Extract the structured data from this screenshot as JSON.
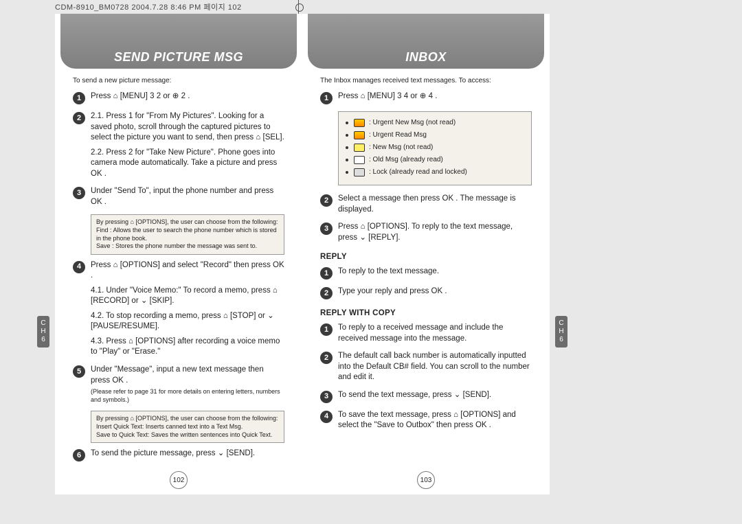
{
  "meta": {
    "top_line": "CDM-8910_BM0728  2004.7.28 8:46 PM  페이지 102"
  },
  "left": {
    "title": "SEND PICTURE MSG",
    "intro": "To send a new picture message:",
    "tab": {
      "a": "C",
      "b": "H",
      "c": "6"
    },
    "step1": "Press ⌂ [MENU] 3 2 or ⊕ 2 .",
    "step2_1": "2.1. Press 1 for \"From My Pictures\". Looking for a saved photo, scroll through the captured pictures to select the picture you want to send, then press ⌂ [SEL].",
    "step2_2": "2.2. Press 2 for \"Take New Picture\". Phone goes into camera mode automatically. Take a picture and press OK .",
    "step3": "Under \"Send To\", input the phone number and press OK .",
    "note1_l1": "By pressing ⌂ [OPTIONS], the user can choose from the following:",
    "note1_l2": "Find : Allows the user to search the phone number which is stored in the phone book.",
    "note1_l3": "Save : Stores the phone number the message was sent to.",
    "step4": "Press ⌂ [OPTIONS] and select \"Record\" then press OK .",
    "step4_1": "4.1. Under \"Voice Memo:\" To record a memo, press ⌂ [RECORD] or ⌄ [SKIP].",
    "step4_2": "4.2. To stop recording a memo, press ⌂ [STOP] or ⌄ [PAUSE/RESUME].",
    "step4_3": "4.3. Press ⌂ [OPTIONS] after recording a voice memo to \"Play\" or \"Erase.\"",
    "step5": "Under \"Message\", input a new text message then press OK .",
    "step5_note": "(Please refer to page 31 for more details on entering letters, numbers and symbols.)",
    "note2_l1": "By pressing ⌂ [OPTIONS], the user can choose from the following:",
    "note2_l2": "Insert Quick Text: Inserts canned text into a Text Msg.",
    "note2_l3": "Save to Quick Text: Saves the written sentences into Quick Text.",
    "step6": "To send the picture message, press ⌄ [SEND].",
    "page_num": "102"
  },
  "right": {
    "title": "INBOX",
    "intro": "The Inbox manages received text messages. To access:",
    "tab": {
      "a": "C",
      "b": "H",
      "c": "6"
    },
    "step1": "Press ⌂ [MENU] 3 4 or ⊕ 4 .",
    "legend": {
      "l1": ": Urgent New Msg (not read)",
      "l2": ": Urgent Read Msg",
      "l3": ": New Msg (not read)",
      "l4": ": Old Msg (already read)",
      "l5": ": Lock (already read and locked)"
    },
    "step2": "Select a message then press OK . The message is displayed.",
    "step3": "Press ⌂ [OPTIONS]. To reply to the text message, press ⌄ [REPLY].",
    "reply_head": "REPLY",
    "reply_1": "To reply to the text message.",
    "reply_2": "Type your reply and press OK .",
    "replycopy_head": "REPLY WITH COPY",
    "rc_1": "To reply to a received message and include the received message into the message.",
    "rc_2": "The default call back number is automatically inputted into the Default CB# field. You can scroll to the number and edit it.",
    "rc_3": "To send the text message, press ⌄ [SEND].",
    "rc_4": "To save the text message, press ⌂ [OPTIONS] and select the \"Save to Outbox\" then press OK .",
    "page_num": "103"
  }
}
